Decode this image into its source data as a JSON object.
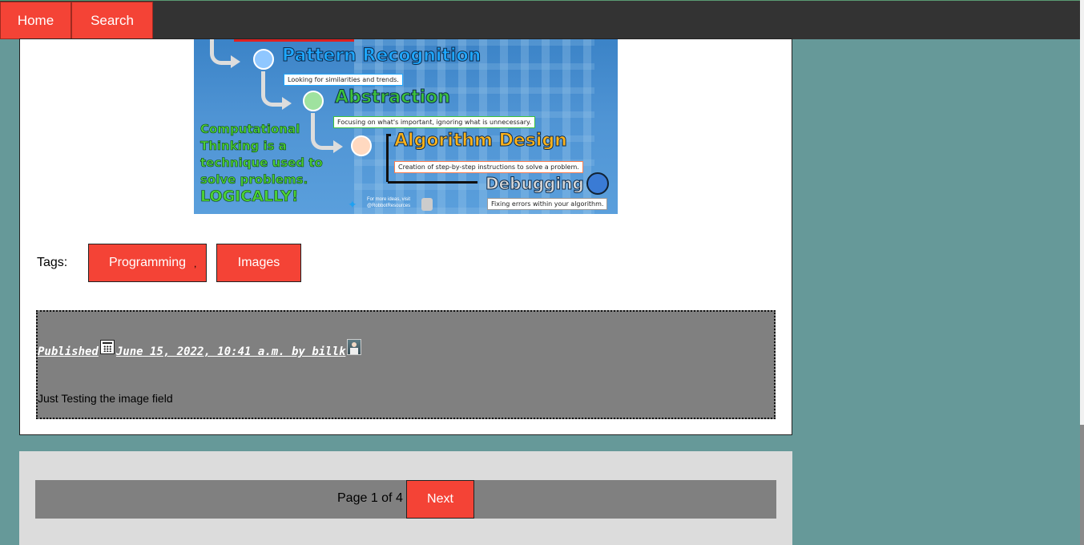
{
  "nav": {
    "home_label": "Home",
    "search_label": "Search"
  },
  "infographic": {
    "headline_lines": [
      "Computational",
      "Thinking is a",
      "technique used to",
      "solve problems.",
      "LOGICALLY!"
    ],
    "steps": [
      {
        "title": "Pattern Recognition",
        "caption": "Looking for similarities and trends.",
        "color": "#1ea7ff"
      },
      {
        "title": "Abstraction",
        "caption": "Focusing on what's important, ignoring what is unnecessary.",
        "color": "#3cc23c"
      },
      {
        "title": "Algorithm Design",
        "caption": "Creation of step-by-step instructions to solve a problem.",
        "color": "#ffb31a"
      },
      {
        "title": "Debugging",
        "caption": "Fixing errors within your algorithm.",
        "color": "#d8d8d8"
      }
    ],
    "credit_line1": "For more ideas, visit",
    "credit_line2": "@RobbotResources"
  },
  "tags": {
    "label": "Tags:",
    "separator": ",",
    "items": [
      "Programming",
      "Images"
    ]
  },
  "post_meta": {
    "published_label": "Published",
    "date_text": "June 15, 2022, 10:41 a.m. by billk",
    "description": "Just Testing the image field"
  },
  "pagination": {
    "page_text": "Page 1 of 4",
    "next_label": "Next"
  },
  "colors": {
    "accent": "#f44336",
    "background": "#669999",
    "topbar": "#333333",
    "meta_box": "#808080"
  }
}
